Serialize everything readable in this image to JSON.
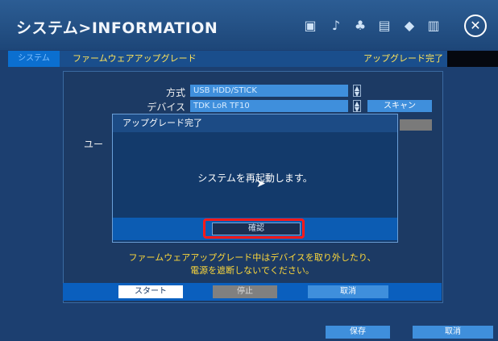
{
  "title": "システム>INFORMATION",
  "toolbar_icons": [
    "monitor-icon",
    "record-icon",
    "network-icon",
    "storage-icon",
    "camera-icon",
    "device-icon"
  ],
  "tab": {
    "active_label": "システム",
    "title": "ファームウェアアップグレード",
    "status": "アップグレード完了"
  },
  "form": {
    "method_label": "方式",
    "method_value": "USB HDD/STICK",
    "device_label": "デバイス",
    "device_value": "TDK LoR TF10",
    "scan_label": "スキャン",
    "user_label": "ユー"
  },
  "dialog": {
    "title": "アップグレード完了",
    "message": "システムを再起動します。",
    "confirm_label": "確認"
  },
  "warning": {
    "line1": "ファームウェアアップグレード中はデバイスを取り外したり、",
    "line2": "電源を遮断しないでください。"
  },
  "buttons": {
    "start": "スタート",
    "stop": "停止",
    "cancel": "取消"
  },
  "footer": {
    "save": "保存",
    "cancel": "取消"
  },
  "colors": {
    "background": "#1c3f70",
    "accent": "#3f8fdc",
    "highlight": "#ff1a1a",
    "warning_text": "#ffd93a"
  }
}
